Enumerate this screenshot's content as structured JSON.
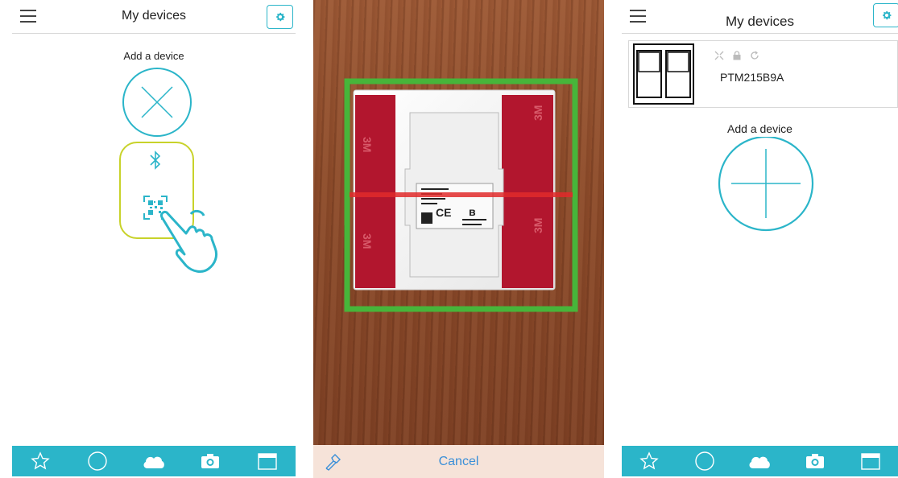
{
  "panel1": {
    "header": {
      "title": "My devices"
    },
    "add_label": "Add a device"
  },
  "panel2": {
    "cancel_label": "Cancel"
  },
  "panel3": {
    "header": {
      "title": "My devices"
    },
    "device": {
      "name": "PTM215B9A"
    },
    "add_label": "Add a device"
  },
  "colors": {
    "accent": "#2bb5c9",
    "highlight": "#c8d22a",
    "scan_frame": "#47b53a",
    "scan_line": "#e02a2a",
    "cancel": "#3a8fd8"
  },
  "icons": {
    "menu": "hamburger-icon",
    "settings": "gear-icon",
    "close": "close-circle-icon",
    "bluetooth": "bluetooth-icon",
    "qr": "qr-code-icon",
    "hand": "pointing-hand-icon",
    "add": "add-circle-icon",
    "nav": [
      "star-icon",
      "circle-icon",
      "cloud-icon",
      "camera-icon",
      "calendar-icon"
    ]
  }
}
